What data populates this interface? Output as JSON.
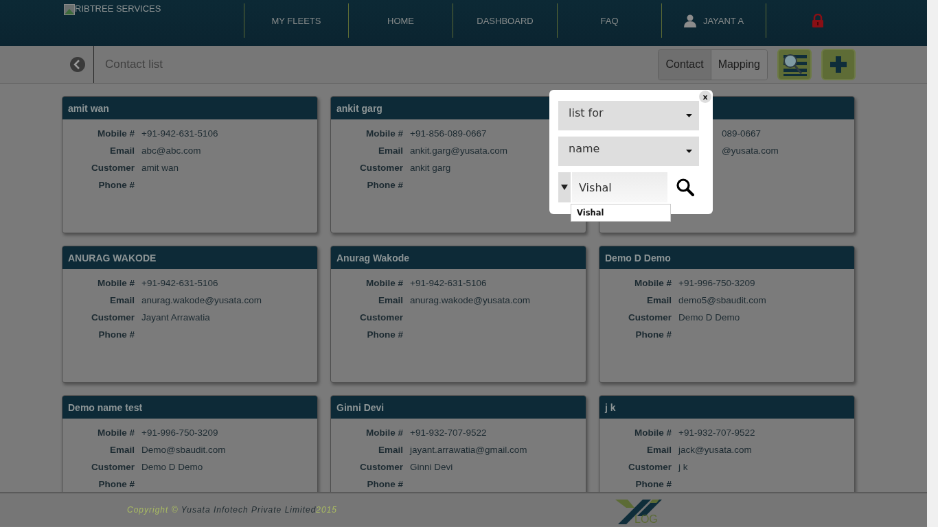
{
  "brand": {
    "text": "RIBTREE SERVICES"
  },
  "nav": [
    {
      "kind": "link",
      "label": "MY FLEETS"
    },
    {
      "kind": "link",
      "label": "HOME"
    },
    {
      "kind": "link",
      "label": "DASHBOARD"
    },
    {
      "kind": "link",
      "label": "FAQ"
    },
    {
      "kind": "user",
      "label": "JAYANT A"
    },
    {
      "kind": "lock"
    }
  ],
  "page_title": "Contact list",
  "tabs": [
    {
      "label": "Contact",
      "selected": true
    },
    {
      "label": "Mapping",
      "selected": false
    }
  ],
  "cards": [
    {
      "name": "amit wan",
      "fields": [
        {
          "label": "Mobile #",
          "value": "+91-942-631-5106"
        },
        {
          "label": "Email",
          "value": "abc@abc.com"
        },
        {
          "label": "Customer",
          "value": "amit wan"
        },
        {
          "label": "Phone #"
        }
      ]
    },
    {
      "name": "ankit garg",
      "fields": [
        {
          "label": "Mobile #",
          "value": "+91-856-089-0667"
        },
        {
          "label": "Email",
          "value": "ankit.garg@yusata.com"
        },
        {
          "label": "Customer",
          "value": "ankit garg"
        },
        {
          "label": "Phone #"
        }
      ]
    },
    {
      "fields": [
        {
          "value": "089-0667"
        },
        {
          "value": "@yusata.com"
        }
      ]
    },
    {
      "name": "ANURAG WAKODE",
      "fields": [
        {
          "label": "Mobile #",
          "value": "+91-942-631-5106"
        },
        {
          "label": "Email",
          "value": "anurag.wakode@yusata.com"
        },
        {
          "label": "Customer",
          "value": "Jayant Arrawatia"
        },
        {
          "label": "Phone #"
        }
      ]
    },
    {
      "name": "Anurag Wakode",
      "fields": [
        {
          "label": "Mobile #",
          "value": "+91-942-631-5106"
        },
        {
          "label": "Email",
          "value": "anurag.wakode@yusata.com"
        },
        {
          "label": "Customer"
        },
        {
          "label": "Phone #"
        }
      ]
    },
    {
      "name": "Demo D Demo",
      "fields": [
        {
          "label": "Mobile #",
          "value": "+91-996-750-3209"
        },
        {
          "label": "Email",
          "value": "demo5@sbaudit.com"
        },
        {
          "label": "Customer",
          "value": "Demo D Demo"
        },
        {
          "label": "Phone #"
        }
      ]
    },
    {
      "name": "Demo name test",
      "fields": [
        {
          "label": "Mobile #",
          "value": "+91-996-750-3209"
        },
        {
          "label": "Email",
          "value": "Demo@sbaudit.com"
        },
        {
          "label": "Customer",
          "value": "Demo D Demo"
        },
        {
          "label": "Phone #"
        }
      ]
    },
    {
      "name": "Ginni Devi",
      "fields": [
        {
          "label": "Mobile #",
          "value": "+91-932-707-9522"
        },
        {
          "label": "Email",
          "value": "jayant.arrawatia@gmail.com"
        },
        {
          "label": "Customer",
          "value": "Ginni Devi"
        },
        {
          "label": "Phone #"
        }
      ]
    },
    {
      "name": "j k",
      "fields": [
        {
          "label": "Mobile #",
          "value": "+91-932-707-9522"
        },
        {
          "label": "Email",
          "value": "jack@yusata.com"
        },
        {
          "label": "Customer",
          "value": "j k"
        },
        {
          "label": "Phone #"
        }
      ]
    }
  ],
  "modal": {
    "close": "x",
    "selects": [
      {
        "value": "list for"
      },
      {
        "value": "name"
      }
    ],
    "search": {
      "value": "Vishal"
    },
    "suggestions": [
      "Vishal"
    ]
  },
  "footer": {
    "copyright": "Copyright ©",
    "company": "Yusata Infotech Private Limited",
    "year": "2015",
    "logo_text": "LOG"
  }
}
